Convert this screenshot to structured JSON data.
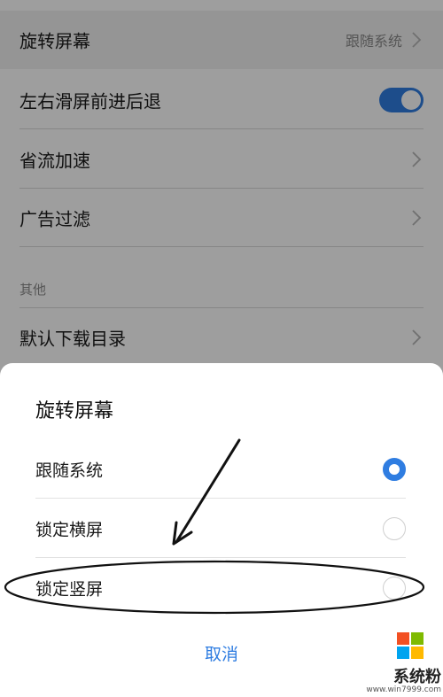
{
  "settings": {
    "rotate": {
      "label": "旋转屏幕",
      "value": "跟随系统"
    },
    "swipe": {
      "label": "左右滑屏前进后退",
      "toggle_on": true
    },
    "save_data": {
      "label": "省流加速"
    },
    "ad_filter": {
      "label": "广告过滤"
    },
    "section_other": "其他",
    "download_dir": {
      "label": "默认下载目录"
    }
  },
  "dialog": {
    "title": "旋转屏幕",
    "options": [
      {
        "label": "跟随系统",
        "selected": true
      },
      {
        "label": "锁定横屏",
        "selected": false
      },
      {
        "label": "锁定竖屏",
        "selected": false
      }
    ],
    "cancel_label": "取消"
  },
  "watermark": {
    "text": "系统粉",
    "url": "www.win7999.com"
  },
  "colors": {
    "accent": "#2f7de1",
    "ms_red": "#f25022",
    "ms_green": "#7fba00",
    "ms_blue": "#00a4ef",
    "ms_yellow": "#ffb900"
  },
  "icons": {
    "chevron": "chevron-right-icon",
    "logo": "windows-logo-icon"
  }
}
